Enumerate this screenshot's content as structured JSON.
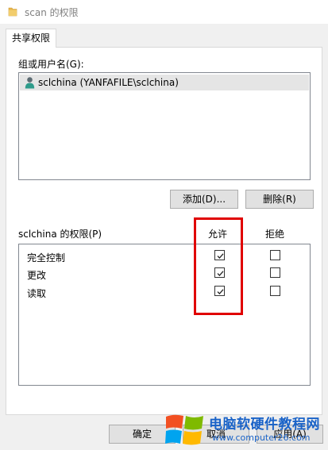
{
  "window": {
    "title": "scan 的权限"
  },
  "tabs": [
    {
      "label": "共享权限"
    }
  ],
  "groups": {
    "label": "组或用户名(G):",
    "items": [
      {
        "name": "sclchina (YANFAFILE\\sclchina)",
        "icon": "user-icon",
        "selected": true
      }
    ]
  },
  "actions": {
    "add_label": "添加(D)...",
    "remove_label": "删除(R)"
  },
  "permissions": {
    "label": "sclchina 的权限(P)",
    "allow_header": "允许",
    "deny_header": "拒绝",
    "rows": [
      {
        "name": "完全控制",
        "allow": true,
        "deny": false
      },
      {
        "name": "更改",
        "allow": true,
        "deny": false
      },
      {
        "name": "读取",
        "allow": true,
        "deny": false
      }
    ]
  },
  "footer": {
    "ok_label": "确定",
    "cancel_label": "取消",
    "apply_label": "应用(A)"
  },
  "watermark": {
    "title": "电脑软硬件教程网",
    "url": "www.computer26.com"
  },
  "colors": {
    "highlight": "#e00000",
    "selection": "#e5e5e5",
    "watermark": "#1a63c8"
  }
}
